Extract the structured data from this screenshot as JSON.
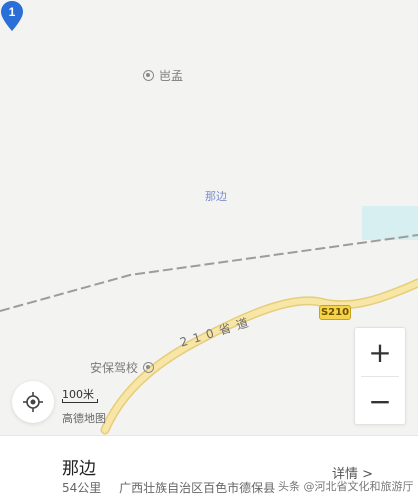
{
  "map": {
    "poi_top": "岜孟",
    "selected_marker": {
      "number": "1",
      "label": "那边"
    },
    "poi_bottom": "安保驾校",
    "road_shield": "S210",
    "road_label": "210省道"
  },
  "controls": {
    "zoom_in": "+",
    "zoom_out": "−",
    "scale": "100米",
    "brand": "高德地图"
  },
  "panel": {
    "title": "那边",
    "distance": "54公里",
    "address": "广西壮族自治区百色市德保县",
    "details": "详情 >"
  },
  "watermark": "头条 @河北省文化和旅游厅",
  "colors": {
    "marker": "#2a6fd8",
    "road": "#f0d98a",
    "water": "#d7eff0"
  }
}
